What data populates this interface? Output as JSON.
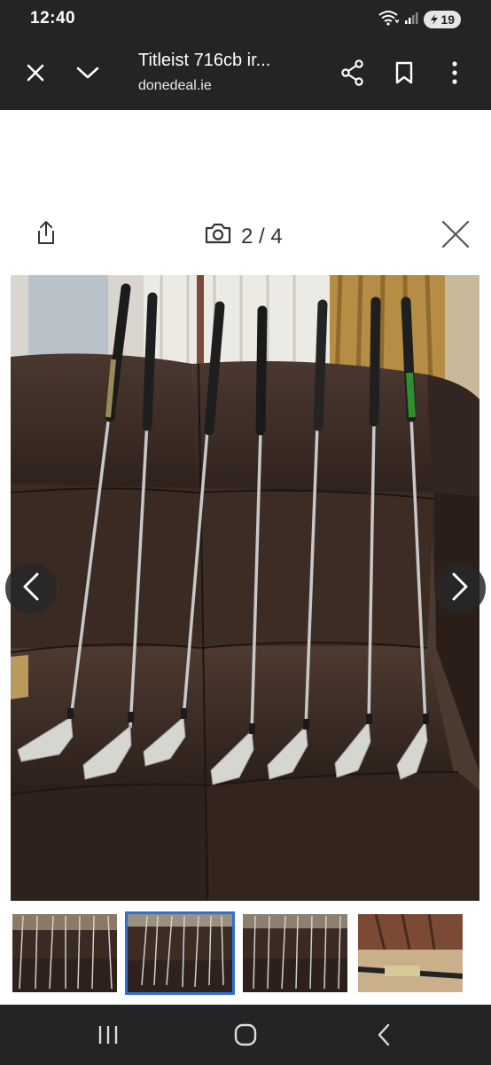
{
  "status": {
    "time": "12:40",
    "battery": "19",
    "icons": [
      "wifi-icon",
      "signal-icon",
      "battery-icon"
    ]
  },
  "toolbar": {
    "title": "Titleist 716cb ir...",
    "url": "donedeal.ie",
    "icons": [
      "close-icon",
      "chevron-down-icon",
      "share-icon",
      "bookmark-icon",
      "more-vert-icon"
    ]
  },
  "viewer": {
    "counter": "2 / 4",
    "icons": [
      "upload-share-icon",
      "camera-icon",
      "close-icon",
      "chevron-left-icon",
      "chevron-right-icon"
    ]
  },
  "photo": {
    "description_icon": "golf-clubs-photo"
  },
  "thumbnails": {
    "count": 4,
    "active_index": 1
  },
  "navbar": {
    "icons": [
      "recents-icon",
      "home-icon",
      "back-icon"
    ]
  },
  "colors": {
    "bar_bg": "#222426",
    "active_thumb": "#2f6fd6",
    "sofa": "#3b2a22"
  }
}
